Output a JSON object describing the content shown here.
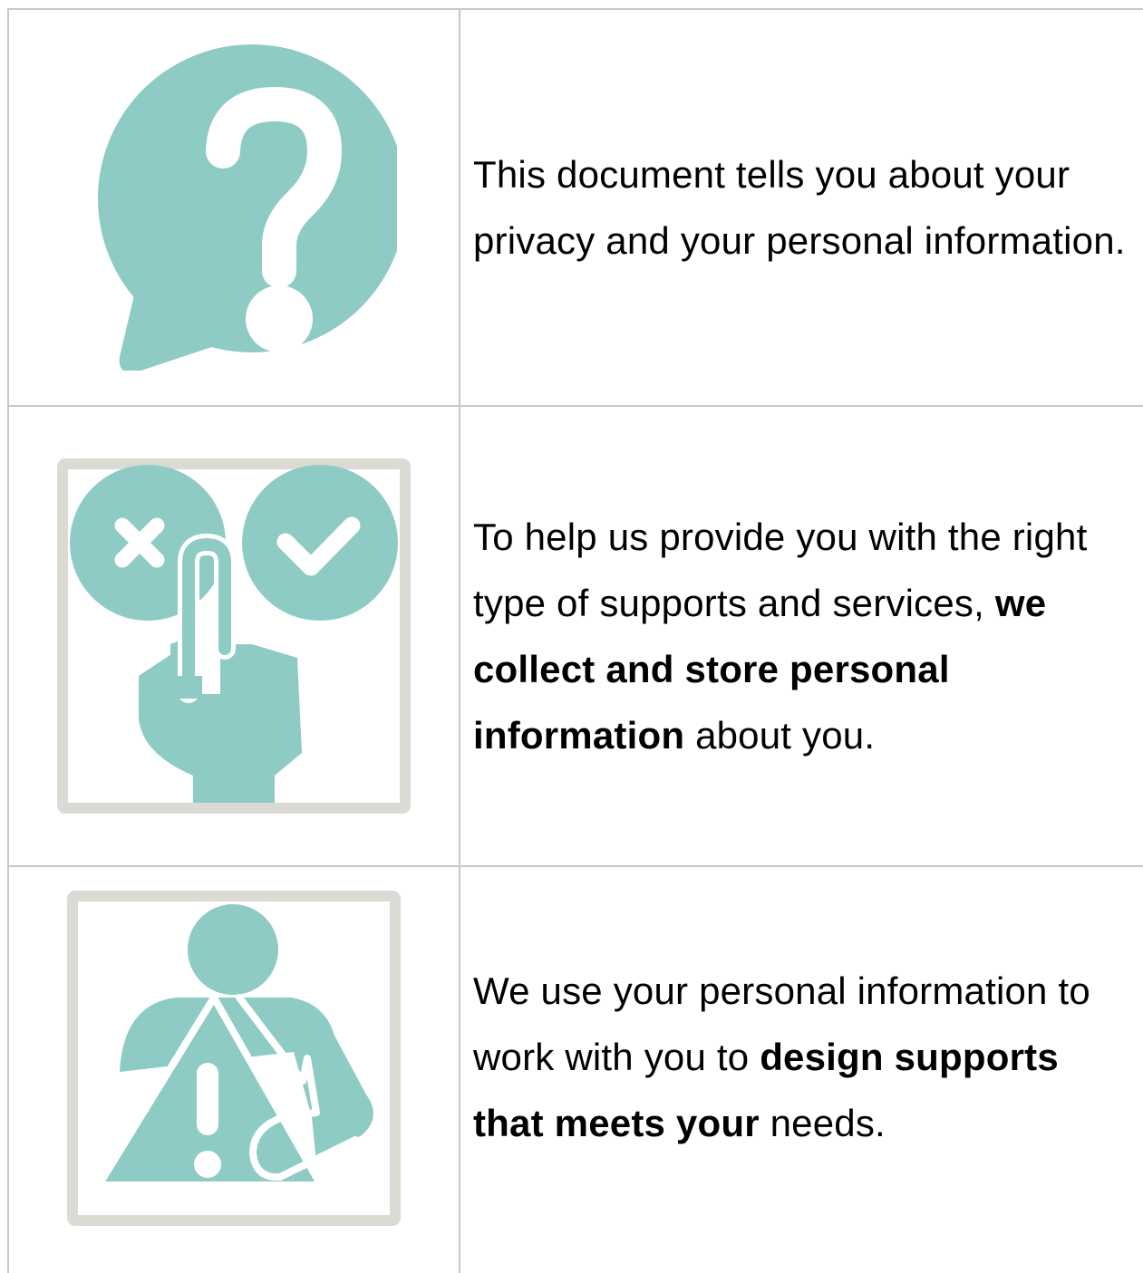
{
  "colors": {
    "accent": "#8ecbc5",
    "frame": "#dcdad5",
    "rule": "#c8c8c8"
  },
  "rows": [
    {
      "icon": "question-speech-bubble-icon",
      "text": "This document tells you about your privacy and your personal information."
    },
    {
      "icon": "choice-hand-icon",
      "pre": "To help us provide you with the right type of supports and services,",
      "bold": "we collect and store personal information",
      "post": "about you."
    },
    {
      "icon": "person-warning-icon",
      "pre": "We use your personal information to work with you to",
      "bold": "design supports that meets your",
      "post": "needs."
    }
  ]
}
